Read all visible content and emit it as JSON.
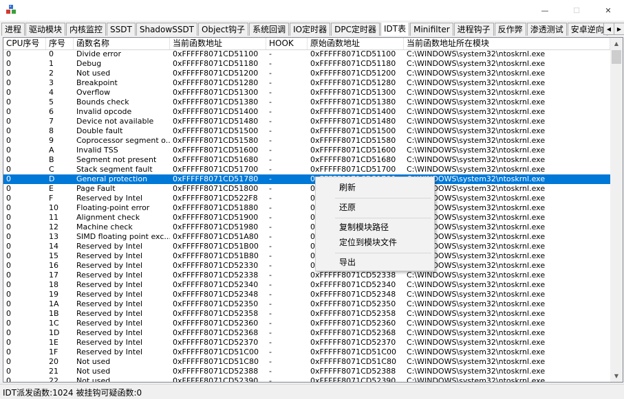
{
  "window": {
    "minimize_glyph": "—",
    "maximize_glyph": "☐",
    "close_glyph": "✕",
    "icon": "app-cubes-icon"
  },
  "tabs": [
    {
      "label": "进程"
    },
    {
      "label": "驱动模块"
    },
    {
      "label": "内核监控"
    },
    {
      "label": "SSDT"
    },
    {
      "label": "ShadowSSDT"
    },
    {
      "label": "Object钩子"
    },
    {
      "label": "系统回调"
    },
    {
      "label": "IO定时器"
    },
    {
      "label": "DPC定时器"
    },
    {
      "label": "IDT表",
      "active": true
    },
    {
      "label": "Minifilter"
    },
    {
      "label": "进程钩子"
    },
    {
      "label": "反作弊"
    },
    {
      "label": "渗透测试"
    },
    {
      "label": "安卓逆向"
    }
  ],
  "tab_scroll": {
    "left": "◀",
    "right": "▶"
  },
  "columns": [
    "CPU序号",
    "序号",
    "函数名称",
    "当前函数地址",
    "HOOK",
    "原始函数地址",
    "当前函数地址所在模块"
  ],
  "rows": [
    [
      "0",
      "0",
      "Divide error",
      "0xFFFFF8071CD51100",
      "-",
      "0xFFFFF8071CD51100",
      "C:\\WINDOWS\\system32\\ntoskrnl.exe"
    ],
    [
      "0",
      "1",
      "Debug",
      "0xFFFFF8071CD51180",
      "-",
      "0xFFFFF8071CD51180",
      "C:\\WINDOWS\\system32\\ntoskrnl.exe"
    ],
    [
      "0",
      "2",
      "Not used",
      "0xFFFFF8071CD51200",
      "-",
      "0xFFFFF8071CD51200",
      "C:\\WINDOWS\\system32\\ntoskrnl.exe"
    ],
    [
      "0",
      "3",
      "Breakpoint",
      "0xFFFFF8071CD51280",
      "-",
      "0xFFFFF8071CD51280",
      "C:\\WINDOWS\\system32\\ntoskrnl.exe"
    ],
    [
      "0",
      "4",
      "Overflow",
      "0xFFFFF8071CD51300",
      "-",
      "0xFFFFF8071CD51300",
      "C:\\WINDOWS\\system32\\ntoskrnl.exe"
    ],
    [
      "0",
      "5",
      "Bounds check",
      "0xFFFFF8071CD51380",
      "-",
      "0xFFFFF8071CD51380",
      "C:\\WINDOWS\\system32\\ntoskrnl.exe"
    ],
    [
      "0",
      "6",
      "Invalid opcode",
      "0xFFFFF8071CD51400",
      "-",
      "0xFFFFF8071CD51400",
      "C:\\WINDOWS\\system32\\ntoskrnl.exe"
    ],
    [
      "0",
      "7",
      "Device not available",
      "0xFFFFF8071CD51480",
      "-",
      "0xFFFFF8071CD51480",
      "C:\\WINDOWS\\system32\\ntoskrnl.exe"
    ],
    [
      "0",
      "8",
      "Double fault",
      "0xFFFFF8071CD51500",
      "-",
      "0xFFFFF8071CD51500",
      "C:\\WINDOWS\\system32\\ntoskrnl.exe"
    ],
    [
      "0",
      "9",
      "Coprocessor segment o...",
      "0xFFFFF8071CD51580",
      "-",
      "0xFFFFF8071CD51580",
      "C:\\WINDOWS\\system32\\ntoskrnl.exe"
    ],
    [
      "0",
      "A",
      "Invalid TSS",
      "0xFFFFF8071CD51600",
      "-",
      "0xFFFFF8071CD51600",
      "C:\\WINDOWS\\system32\\ntoskrnl.exe"
    ],
    [
      "0",
      "B",
      "Segment not present",
      "0xFFFFF8071CD51680",
      "-",
      "0xFFFFF8071CD51680",
      "C:\\WINDOWS\\system32\\ntoskrnl.exe"
    ],
    [
      "0",
      "C",
      "Stack segment fault",
      "0xFFFFF8071CD51700",
      "-",
      "0xFFFFF8071CD51700",
      "C:\\WINDOWS\\system32\\ntoskrnl.exe"
    ],
    [
      "0",
      "D",
      "General protection",
      "0xFFFFF8071CD51780",
      "-",
      "0xFFFFF8071CD51780",
      "C:\\WINDOWS\\system32\\ntoskrnl.exe"
    ],
    [
      "0",
      "E",
      "Page Fault",
      "0xFFFFF8071CD51800",
      "-",
      "0xFFFFF8071CD51800",
      "C:\\WINDOWS\\system32\\ntoskrnl.exe"
    ],
    [
      "0",
      "F",
      "Reserved by Intel",
      "0xFFFFF8071CD522F8",
      "-",
      "0xFFFFF8071CD522F8",
      "C:\\WINDOWS\\system32\\ntoskrnl.exe"
    ],
    [
      "0",
      "10",
      "Floating-point error",
      "0xFFFFF8071CD51880",
      "-",
      "0xFFFFF8071CD51880",
      "C:\\WINDOWS\\system32\\ntoskrnl.exe"
    ],
    [
      "0",
      "11",
      "Alignment check",
      "0xFFFFF8071CD51900",
      "-",
      "0xFFFFF8071CD51900",
      "C:\\WINDOWS\\system32\\ntoskrnl.exe"
    ],
    [
      "0",
      "12",
      "Machine check",
      "0xFFFFF8071CD51980",
      "-",
      "0xFFFFF8071CD51980",
      "C:\\WINDOWS\\system32\\ntoskrnl.exe"
    ],
    [
      "0",
      "13",
      "SIMD floating point exc...",
      "0xFFFFF8071CD51A80",
      "-",
      "0xFFFFF8071CD51A80",
      "C:\\WINDOWS\\system32\\ntoskrnl.exe"
    ],
    [
      "0",
      "14",
      "Reserved by Intel",
      "0xFFFFF8071CD51B00",
      "-",
      "0xFFFFF8071CD51B00",
      "C:\\WINDOWS\\system32\\ntoskrnl.exe"
    ],
    [
      "0",
      "15",
      "Reserved by Intel",
      "0xFFFFF8071CD51B80",
      "-",
      "0xFFFFF8071CD51B80",
      "C:\\WINDOWS\\system32\\ntoskrnl.exe"
    ],
    [
      "0",
      "16",
      "Reserved by Intel",
      "0xFFFFF8071CD52330",
      "-",
      "0xFFFFF8071CD52330",
      "C:\\WINDOWS\\system32\\ntoskrnl.exe"
    ],
    [
      "0",
      "17",
      "Reserved by Intel",
      "0xFFFFF8071CD52338",
      "-",
      "0xFFFFF8071CD52338",
      "C:\\WINDOWS\\system32\\ntoskrnl.exe"
    ],
    [
      "0",
      "18",
      "Reserved by Intel",
      "0xFFFFF8071CD52340",
      "-",
      "0xFFFFF8071CD52340",
      "C:\\WINDOWS\\system32\\ntoskrnl.exe"
    ],
    [
      "0",
      "19",
      "Reserved by Intel",
      "0xFFFFF8071CD52348",
      "-",
      "0xFFFFF8071CD52348",
      "C:\\WINDOWS\\system32\\ntoskrnl.exe"
    ],
    [
      "0",
      "1A",
      "Reserved by Intel",
      "0xFFFFF8071CD52350",
      "-",
      "0xFFFFF8071CD52350",
      "C:\\WINDOWS\\system32\\ntoskrnl.exe"
    ],
    [
      "0",
      "1B",
      "Reserved by Intel",
      "0xFFFFF8071CD52358",
      "-",
      "0xFFFFF8071CD52358",
      "C:\\WINDOWS\\system32\\ntoskrnl.exe"
    ],
    [
      "0",
      "1C",
      "Reserved by Intel",
      "0xFFFFF8071CD52360",
      "-",
      "0xFFFFF8071CD52360",
      "C:\\WINDOWS\\system32\\ntoskrnl.exe"
    ],
    [
      "0",
      "1D",
      "Reserved by Intel",
      "0xFFFFF8071CD52368",
      "-",
      "0xFFFFF8071CD52368",
      "C:\\WINDOWS\\system32\\ntoskrnl.exe"
    ],
    [
      "0",
      "1E",
      "Reserved by Intel",
      "0xFFFFF8071CD52370",
      "-",
      "0xFFFFF8071CD52370",
      "C:\\WINDOWS\\system32\\ntoskrnl.exe"
    ],
    [
      "0",
      "1F",
      "Reserved by Intel",
      "0xFFFFF8071CD51C00",
      "-",
      "0xFFFFF8071CD51C00",
      "C:\\WINDOWS\\system32\\ntoskrnl.exe"
    ],
    [
      "0",
      "20",
      "Not used",
      "0xFFFFF8071CD51C80",
      "-",
      "0xFFFFF8071CD51C80",
      "C:\\WINDOWS\\system32\\ntoskrnl.exe"
    ],
    [
      "0",
      "21",
      "Not used",
      "0xFFFFF8071CD52388",
      "-",
      "0xFFFFF8071CD52388",
      "C:\\WINDOWS\\system32\\ntoskrnl.exe"
    ],
    [
      "0",
      "22",
      "Not used",
      "0xFFFFF8071CD52390",
      "-",
      "0xFFFFF8071CD52390",
      "C:\\WINDOWS\\system32\\ntoskrnl.exe"
    ]
  ],
  "selected_row": 13,
  "selection_color": "#0078d7",
  "scrollbar": {
    "up": "▲",
    "down": "▼"
  },
  "context_menu": {
    "items": [
      "刷新",
      "还原",
      "复制模块路径",
      "定位到模块文件",
      "导出"
    ]
  },
  "status": {
    "text": "IDT派发函数:1024  被挂钩可疑函数:0"
  }
}
